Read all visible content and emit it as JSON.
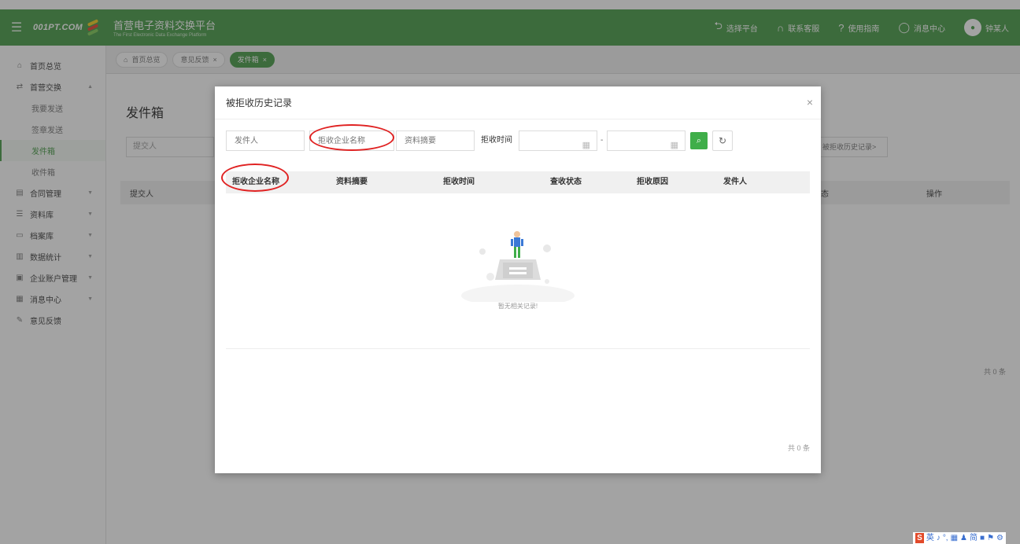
{
  "topbar": {
    "logo_text": "001PT.COM",
    "platform_name": "首营电子资料交换平台",
    "platform_sub": "The First Electronic Data Exchange Platform",
    "items": [
      {
        "icon": "return-icon",
        "glyph": "⮌",
        "label": "选择平台"
      },
      {
        "icon": "headset-icon",
        "glyph": "∩",
        "label": "联系客服"
      },
      {
        "icon": "help-icon",
        "glyph": "?",
        "label": "使用指南"
      },
      {
        "icon": "bell-icon",
        "glyph": "◯",
        "label": "消息中心"
      }
    ],
    "user_name": "钟某人",
    "colors": {
      "bar": "#5fa85e",
      "accent": "#3fae49",
      "highlight": "#e02222"
    }
  },
  "sidebar": {
    "items": [
      {
        "icon": "home-icon",
        "glyph": "⌂",
        "label": "首页总览",
        "level": "top"
      },
      {
        "icon": "exchange-icon",
        "glyph": "⇄",
        "label": "首营交换",
        "level": "top",
        "arrow": "▲"
      },
      {
        "label": "我要发送",
        "level": "sub"
      },
      {
        "label": "签章发送",
        "level": "sub"
      },
      {
        "label": "发件箱",
        "level": "sub",
        "active": true
      },
      {
        "label": "收件箱",
        "level": "sub"
      },
      {
        "icon": "contract-icon",
        "glyph": "▤",
        "label": "合同管理",
        "level": "top",
        "arrow": "▼"
      },
      {
        "icon": "library-icon",
        "glyph": "☰",
        "label": "资料库",
        "level": "top",
        "arrow": "▼"
      },
      {
        "icon": "archive-icon",
        "glyph": "▭",
        "label": "档案库",
        "level": "top",
        "arrow": "▼"
      },
      {
        "icon": "stats-icon",
        "glyph": "▥",
        "label": "数据统计",
        "level": "top",
        "arrow": "▼"
      },
      {
        "icon": "account-icon",
        "glyph": "▣",
        "label": "企业账户管理",
        "level": "top",
        "arrow": "▼"
      },
      {
        "icon": "message-icon",
        "glyph": "▦",
        "label": "消息中心",
        "level": "top",
        "arrow": "▼"
      },
      {
        "icon": "feedback-icon",
        "glyph": "✎",
        "label": "意见反馈",
        "level": "top"
      }
    ]
  },
  "tabs": [
    {
      "icon": "home-icon",
      "label": "首页总览",
      "closable": false
    },
    {
      "label": "意见反馈",
      "closable": true
    },
    {
      "label": "发件箱",
      "closable": true,
      "active": true
    }
  ],
  "background": {
    "title": "发件箱",
    "filter_placeholder": "提交人",
    "history_link": "被拒收历史记录>",
    "col_submitter": "提交人",
    "col_status": "态",
    "col_action": "操作",
    "total": "共 0 条"
  },
  "dialog": {
    "title": "被拒收历史记录",
    "close": "×",
    "filters": {
      "sender_placeholder": "发件人",
      "company_placeholder": "拒收企业名称",
      "summary_placeholder": "资料摘要",
      "time_label": "拒收时间",
      "dash": "-",
      "search_glyph": "🔍",
      "reset_glyph": "↻"
    },
    "columns": [
      "拒收企业名称",
      "资料摘要",
      "拒收时间",
      "查收状态",
      "拒收原因",
      "发件人"
    ],
    "empty_text": "暂无相关记录!",
    "total": "共 0 条"
  },
  "ime": [
    "英",
    "♪",
    "°,",
    "▦",
    "♟",
    "简",
    "■",
    "⚑",
    "⚙"
  ]
}
